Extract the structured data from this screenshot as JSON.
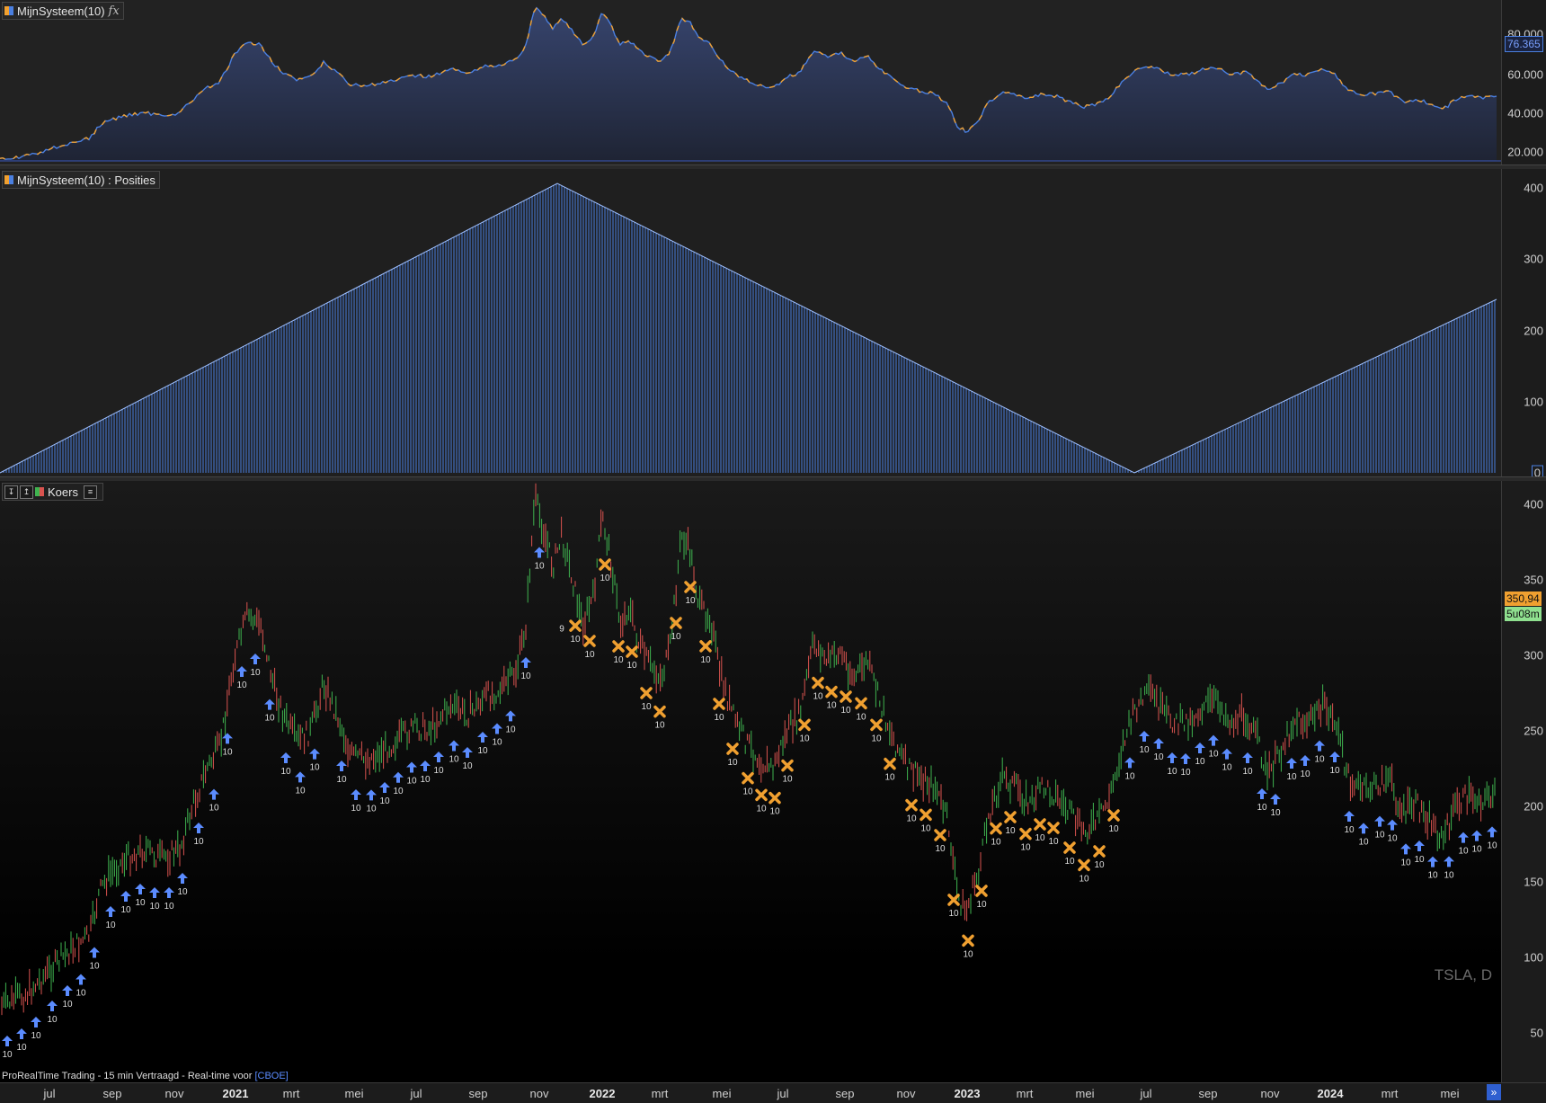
{
  "panels": {
    "equity": {
      "label": "MijnSysteem(10)",
      "fx_glyph": "𝑓x",
      "ticks": [
        "80.000",
        "60.000",
        "40.000",
        "20.000"
      ],
      "last_value": "76.365",
      "last_value_color": "#4a7fe0"
    },
    "positions": {
      "label": "MijnSysteem(10) : Posities",
      "ticks": [
        "400",
        "300",
        "200",
        "100",
        "0"
      ]
    },
    "price": {
      "label": "Koers",
      "symbol": "TSLA, D",
      "ticks": [
        "400",
        "350",
        "300",
        "250",
        "200",
        "150",
        "100",
        "50"
      ],
      "last_price": "350,94",
      "countdown": "5u08m",
      "last_price_color": "#f0a030",
      "countdown_color": "#6fcf6f"
    }
  },
  "x_axis": [
    {
      "label": "jul",
      "year": false
    },
    {
      "label": "sep",
      "year": false
    },
    {
      "label": "nov",
      "year": false
    },
    {
      "label": "2021",
      "year": true
    },
    {
      "label": "mrt",
      "year": false
    },
    {
      "label": "mei",
      "year": false
    },
    {
      "label": "jul",
      "year": false
    },
    {
      "label": "sep",
      "year": false
    },
    {
      "label": "nov",
      "year": false
    },
    {
      "label": "2022",
      "year": true
    },
    {
      "label": "mrt",
      "year": false
    },
    {
      "label": "mei",
      "year": false
    },
    {
      "label": "jul",
      "year": false
    },
    {
      "label": "sep",
      "year": false
    },
    {
      "label": "nov",
      "year": false
    },
    {
      "label": "2023",
      "year": true
    },
    {
      "label": "mrt",
      "year": false
    },
    {
      "label": "mei",
      "year": false
    },
    {
      "label": "jul",
      "year": false
    },
    {
      "label": "sep",
      "year": false
    },
    {
      "label": "nov",
      "year": false
    },
    {
      "label": "2024",
      "year": true
    },
    {
      "label": "mrt",
      "year": false
    },
    {
      "label": "mei",
      "year": false
    }
  ],
  "footer": {
    "text": "ProRealTime Trading - 15 min Vertraagd - Real-time voor",
    "link": "[CBOE]"
  },
  "markers": {
    "buy_quantity": "10",
    "partial_quantity": "9",
    "sell_quantity": "10"
  },
  "colors": {
    "background": "#000000",
    "equity_line_up": "#4a7fe0",
    "equity_line_down": "#f0a030",
    "positions_bar": "#4a7fe0",
    "candle_up": "#3fb34f",
    "candle_down": "#d9534f",
    "buy_arrow": "#5b8cff",
    "sell_cross": "#f0a030"
  },
  "icons": {
    "collapse": "collapse-icon",
    "expand": "expand-icon",
    "list": "list-icon",
    "scroll": "scroll-right-icon"
  }
}
